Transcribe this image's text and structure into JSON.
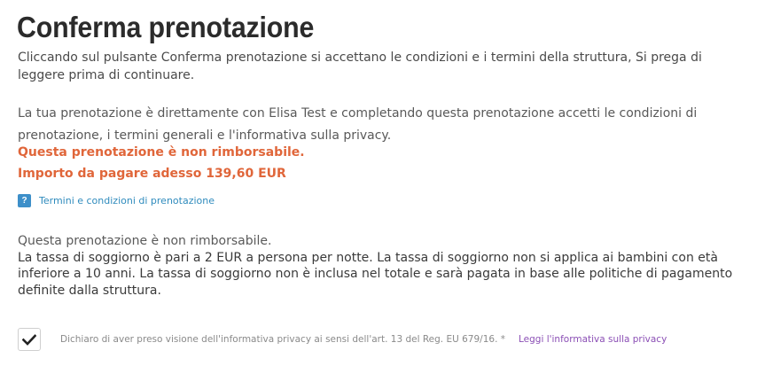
{
  "page": {
    "title": "Conferma prenotazione",
    "intro": "Cliccando sul pulsante Conferma prenotazione si accettano le condizioni e i termini della struttura, Si prega di leggere prima di continuare."
  },
  "booking": {
    "text": "La tua prenotazione è direttamente con Elisa Test e completando questa prenotazione accetti le condizioni di prenotazione, i termini generali e l'informativa sulla privacy.",
    "non_refundable_warning": "Questa prenotazione è non rimborsabile.",
    "amount_due": "Importo da pagare adesso 139,60 EUR"
  },
  "terms": {
    "icon": "help-icon",
    "icon_glyph": "?",
    "link_label": "Termini e condizioni di prenotazione"
  },
  "policy": {
    "line1": "Questa prenotazione è non rimborsabile.",
    "line2": "La tassa di soggiorno è pari a 2 EUR a persona per notte. La tassa di soggiorno non si applica ai bambini con età inferiore a 10 anni. La tassa di soggiorno non è inclusa nel totale e sarà pagata in base alle politiche di pagamento definite dalla struttura."
  },
  "consent": {
    "checked": true,
    "icon": "checkmark-icon",
    "text": "Dichiaro di aver preso visione dell'informativa privacy ai sensi dell'art. 13 del Reg. EU 679/16. *",
    "link_label": "Leggi l'informativa sulla privacy"
  },
  "colors": {
    "warning": "#e0663a",
    "link": "#2f8bbd",
    "privacy_link": "#8b4fb5",
    "help_icon_bg": "#3d8fc9"
  }
}
